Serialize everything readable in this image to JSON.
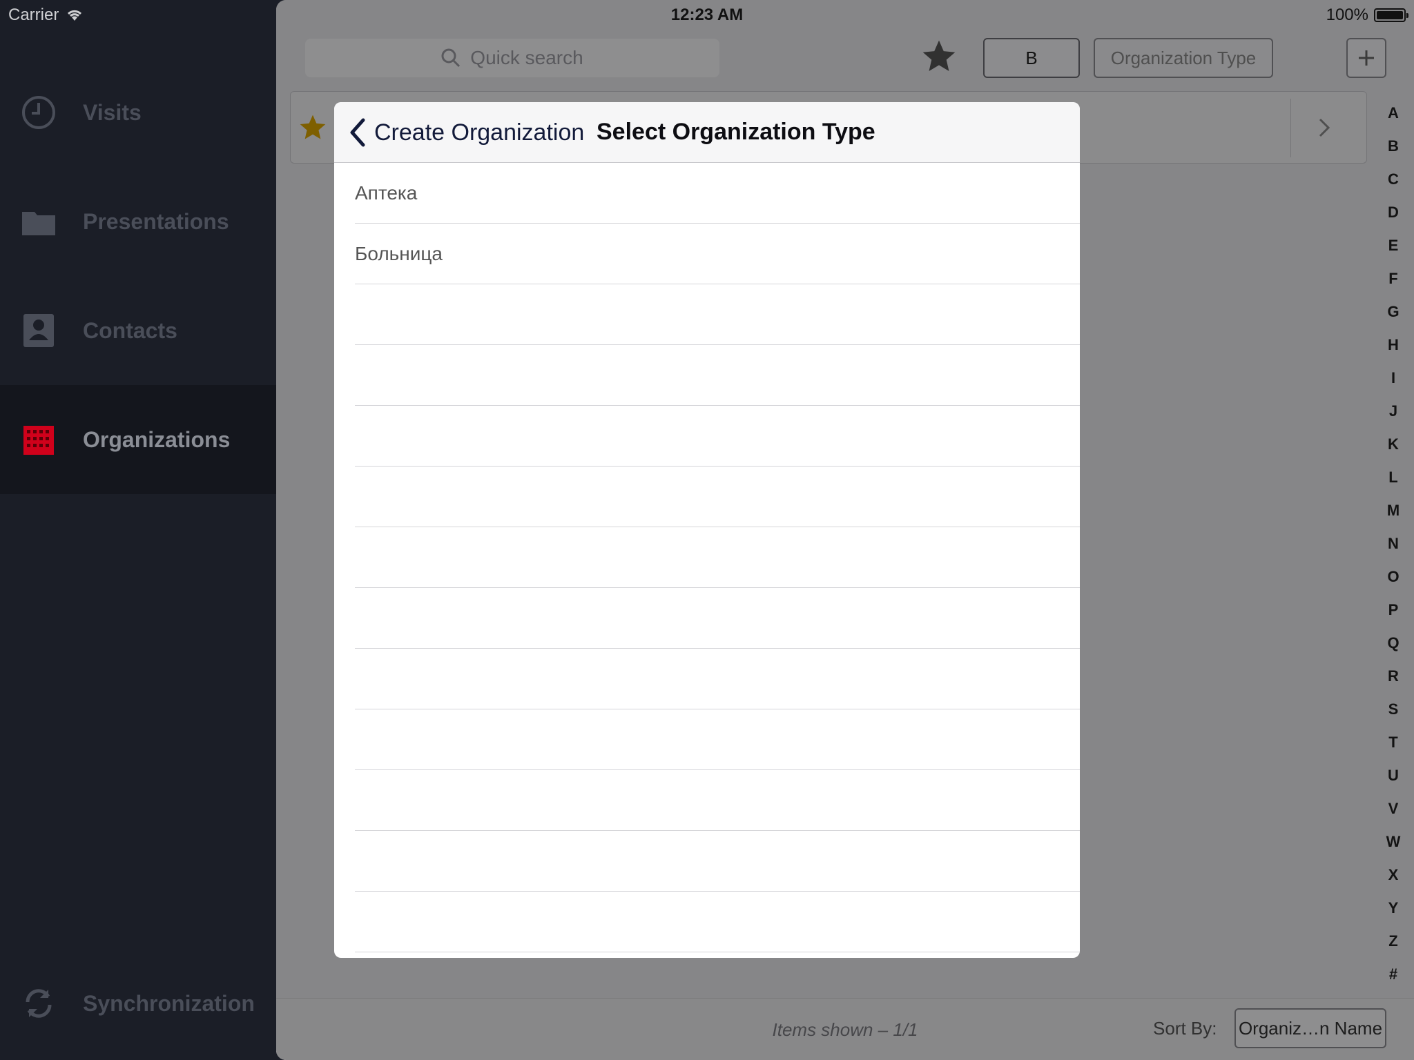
{
  "status_bar": {
    "carrier": "Carrier",
    "time": "12:23 AM",
    "battery": "100%"
  },
  "sidebar": {
    "items": [
      {
        "label": "Visits",
        "icon": "clock-icon"
      },
      {
        "label": "Presentations",
        "icon": "folder-icon"
      },
      {
        "label": "Contacts",
        "icon": "contact-card-icon"
      },
      {
        "label": "Organizations",
        "icon": "building-icon",
        "active": true
      }
    ],
    "sync_label": "Synchronization"
  },
  "toolbar": {
    "search_placeholder": "Quick search",
    "filter_letter": "B",
    "org_type_button": "Organization Type",
    "add_button": "+"
  },
  "alpha_index": [
    "A",
    "B",
    "C",
    "D",
    "E",
    "F",
    "G",
    "H",
    "I",
    "J",
    "K",
    "L",
    "M",
    "N",
    "O",
    "P",
    "Q",
    "R",
    "S",
    "T",
    "U",
    "V",
    "W",
    "X",
    "Y",
    "Z",
    "#"
  ],
  "footer": {
    "items_shown": "Items shown – 1/1",
    "sort_label": "Sort By:",
    "sort_value": "Organiz…n Name"
  },
  "modal": {
    "back_label": "Create Organization",
    "title": "Select Organization Type",
    "options": [
      "Аптека",
      "Больница",
      "",
      "",
      "",
      "",
      "",
      "",
      "",
      "",
      "",
      "",
      "",
      ""
    ]
  },
  "colors": {
    "sidebar_bg": "#1b1e27",
    "active_icon": "#d0011b",
    "star": "#d9a400",
    "back_chevron": "#121a3a"
  }
}
